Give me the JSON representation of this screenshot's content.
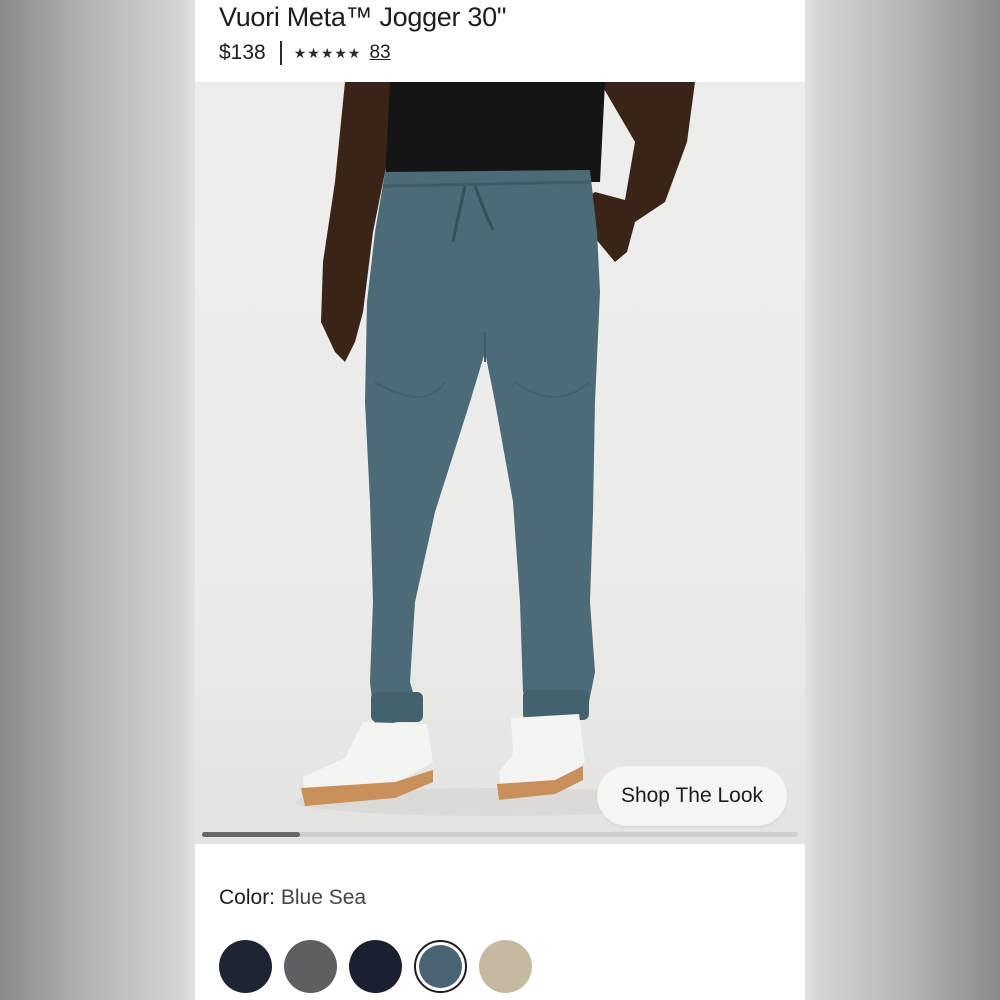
{
  "product": {
    "title": "Vuori Meta™ Jogger 30\"",
    "price": "$138",
    "stars": "★★★★★",
    "rating": 4.5,
    "review_count": "83"
  },
  "gallery": {
    "shop_the_look_label": "Shop The Look",
    "progress": 0.165
  },
  "color": {
    "label": "Color:",
    "selected_name": "Blue Sea",
    "swatches": [
      {
        "hex": "#1f2433",
        "selected": false
      },
      {
        "hex": "#5d5f62",
        "selected": false
      },
      {
        "hex": "#1a2030",
        "selected": false
      },
      {
        "hex": "#4a6474",
        "selected": true
      },
      {
        "hex": "#c6b9a2",
        "selected": false
      }
    ]
  },
  "colors": {
    "jogger": "#4b6b78",
    "skin": "#3a2418",
    "shirt": "#151515"
  }
}
